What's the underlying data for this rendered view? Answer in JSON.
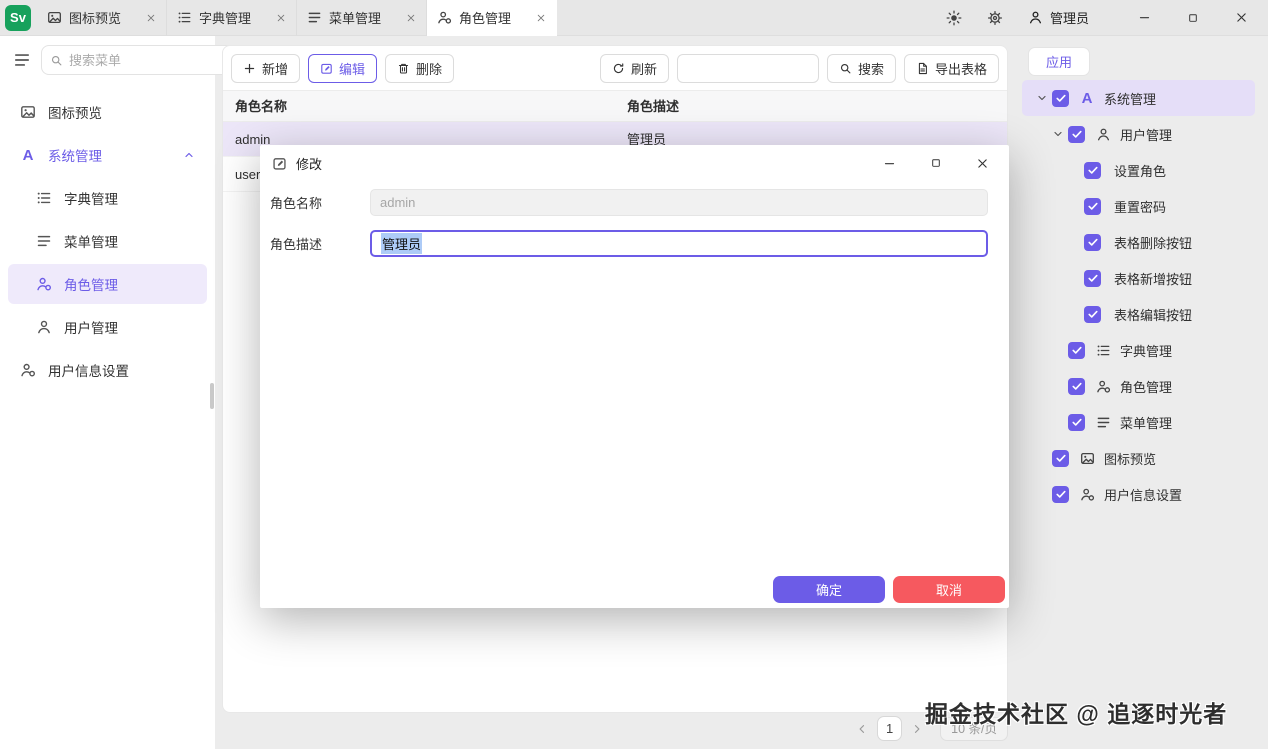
{
  "colors": {
    "accent": "#6C5CE7",
    "danger": "#F6595F",
    "logo_green": "#17A15C"
  },
  "titlebar": {
    "logo_text": "Sv",
    "tabs": [
      {
        "label": "图标预览"
      },
      {
        "label": "字典管理"
      },
      {
        "label": "菜单管理"
      },
      {
        "label": "角色管理"
      }
    ],
    "user_label": "管理员"
  },
  "sidebar": {
    "search_placeholder": "搜索菜单",
    "items": [
      {
        "label": "图标预览"
      },
      {
        "label": "系统管理"
      },
      {
        "label": "字典管理"
      },
      {
        "label": "菜单管理"
      },
      {
        "label": "角色管理"
      },
      {
        "label": "用户管理"
      },
      {
        "label": "用户信息设置"
      }
    ]
  },
  "icons": {
    "system_letter": "A"
  },
  "toolbar": {
    "add_label": "新增",
    "edit_label": "编辑",
    "delete_label": "删除",
    "refresh_label": "刷新",
    "search_label": "搜索",
    "export_label": "导出表格",
    "search_value": ""
  },
  "table": {
    "columns": [
      {
        "label": "角色名称"
      },
      {
        "label": "角色描述"
      }
    ],
    "rows": [
      {
        "name": "admin",
        "desc": "管理员"
      },
      {
        "name": "user",
        "desc": ""
      }
    ]
  },
  "dialog": {
    "title": "修改",
    "fields": [
      {
        "label": "角色名称",
        "value": "admin"
      },
      {
        "label": "角色描述",
        "value": "管理员"
      }
    ],
    "ok_label": "确定",
    "cancel_label": "取消"
  },
  "right_panel": {
    "tab_label": "应用",
    "tree": [
      {
        "label": "系统管理"
      },
      {
        "label": "用户管理"
      },
      {
        "label": "设置角色"
      },
      {
        "label": "重置密码"
      },
      {
        "label": "表格删除按钮"
      },
      {
        "label": "表格新增按钮"
      },
      {
        "label": "表格编辑按钮"
      },
      {
        "label": "字典管理"
      },
      {
        "label": "角色管理"
      },
      {
        "label": "菜单管理"
      },
      {
        "label": "图标预览"
      },
      {
        "label": "用户信息设置"
      }
    ]
  },
  "pagination": {
    "page": "1",
    "page_size": "10 条/页"
  },
  "watermark": "掘金技术社区 @ 追逐时光者"
}
